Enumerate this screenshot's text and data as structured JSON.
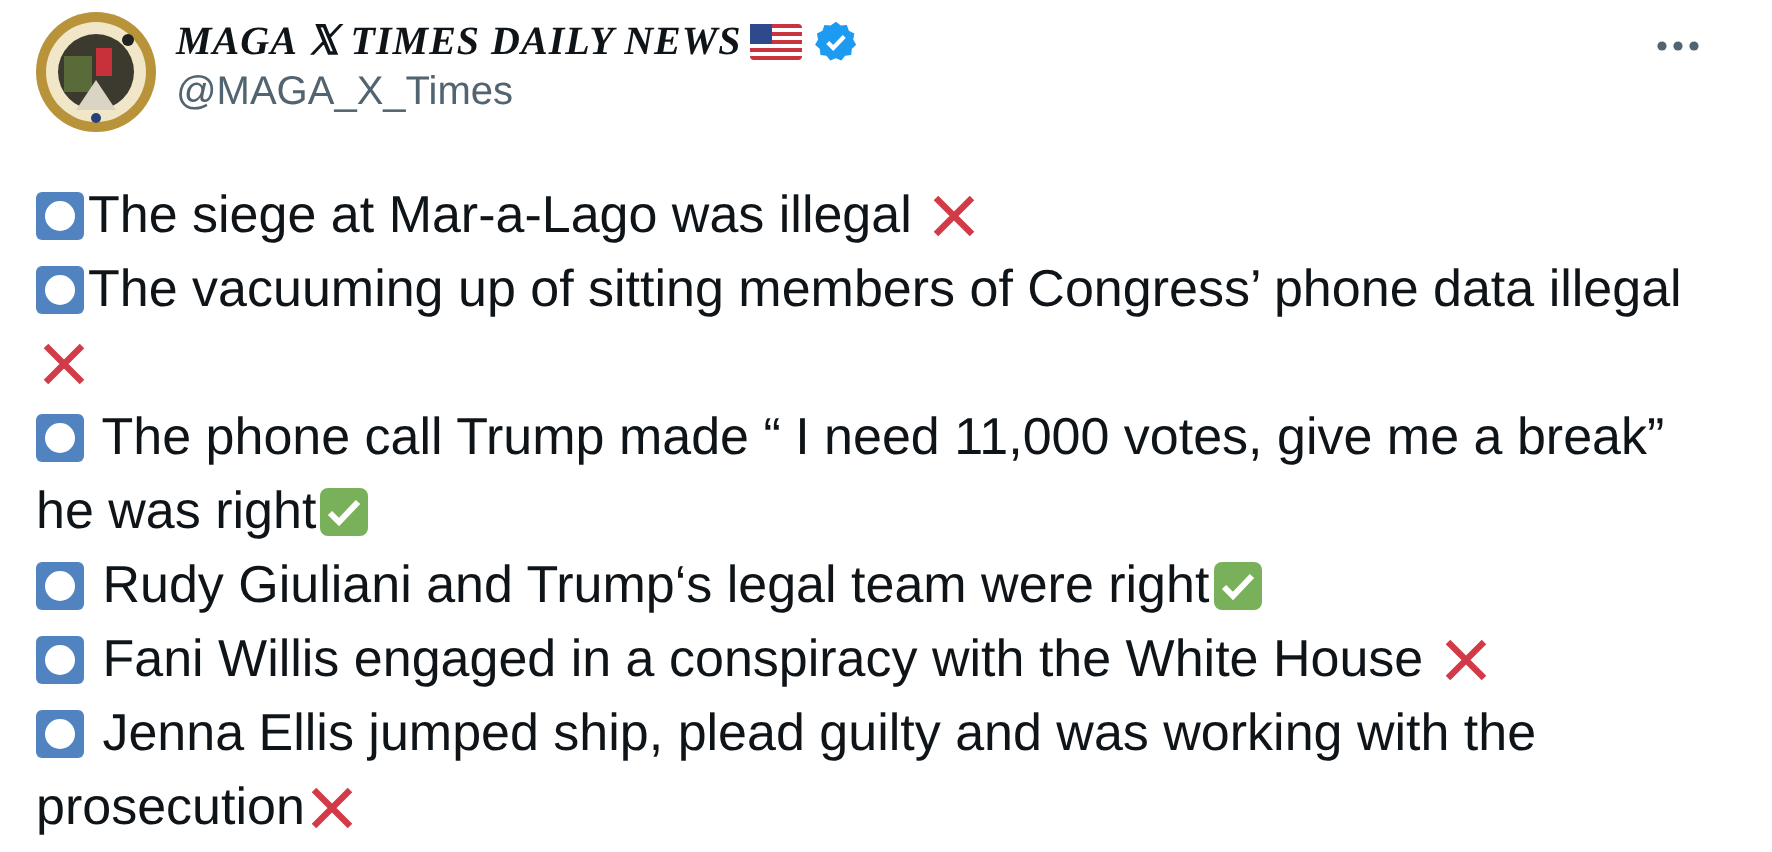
{
  "post": {
    "author_name": "MAGA 𝕏 TIMES DAILY NEWS",
    "handle": "@MAGA_X_Times",
    "verified": true,
    "items": [
      {
        "lines": [
          "The siege at Mar-a-Lago was illegal "
        ],
        "kind": "cross"
      },
      {
        "lines": [
          "The vacuuming up of sitting members of Congress’ phone data illegal"
        ],
        "kind": "cross"
      },
      {
        "lines": [
          " The phone call Trump made “ I need 11,000 votes, give me a break”",
          "he was right"
        ],
        "kind": "check"
      },
      {
        "lines": [
          " Rudy Giuliani and Trump‘s legal team were right"
        ],
        "kind": "check"
      },
      {
        "lines": [
          " Fani Willis engaged in a conspiracy with the White House "
        ],
        "kind": "cross"
      },
      {
        "lines": [
          " Jenna Ellis jumped ship, plead guilty and was working with the",
          "prosecution"
        ],
        "kind": "cross"
      }
    ]
  }
}
